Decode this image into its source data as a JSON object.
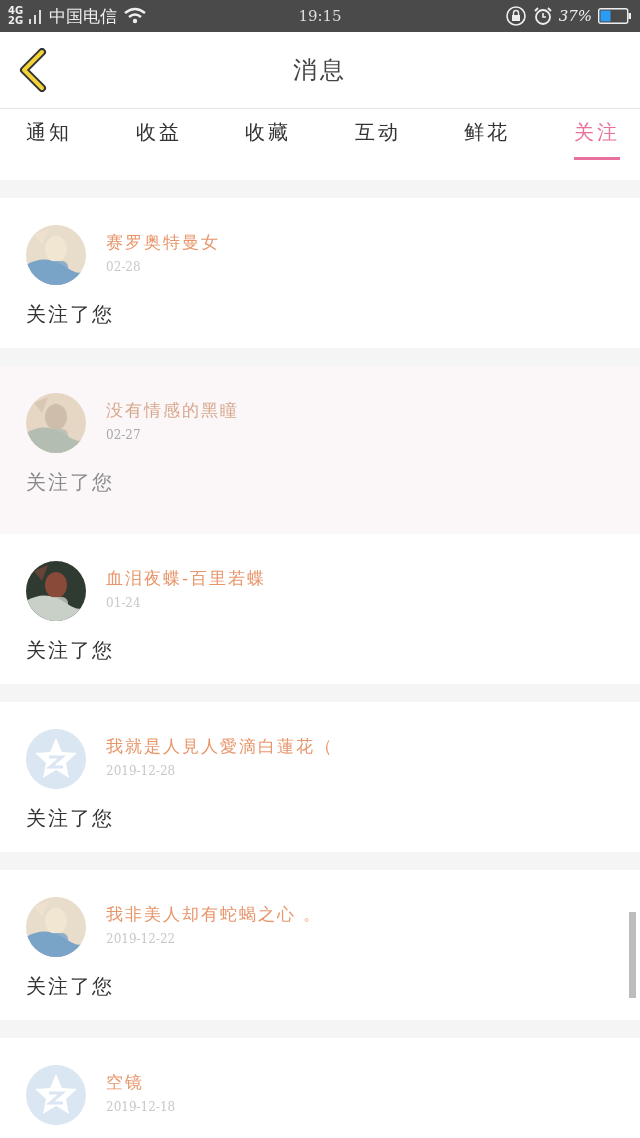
{
  "status_bar": {
    "network_top": "4G",
    "network_bottom": "2G",
    "carrier": "中国电信",
    "time": "19:15",
    "battery": "37%"
  },
  "header": {
    "title": "消息"
  },
  "tabs": [
    {
      "label": "通知",
      "selected": false
    },
    {
      "label": "收益",
      "selected": false
    },
    {
      "label": "收藏",
      "selected": false
    },
    {
      "label": "互动",
      "selected": false
    },
    {
      "label": "鲜花",
      "selected": false
    },
    {
      "label": "关注",
      "selected": true
    }
  ],
  "messages": [
    {
      "kind": "picture",
      "name": "赛罗奥特曼女",
      "date": "02-28",
      "text": "关注了您",
      "dimmed": false
    },
    {
      "kind": "picture",
      "name": "没有情感的黑瞳",
      "date": "02-27",
      "text": "关注了您",
      "dimmed": true
    },
    {
      "kind": "picture",
      "name": "血泪夜蝶-百里若蝶",
      "date": "01-24",
      "text": "关注了您",
      "dimmed": false
    },
    {
      "kind": "default",
      "name": "我就是人見人愛滴白蓮花（",
      "date": "2019-12-28",
      "text": "关注了您",
      "dimmed": false
    },
    {
      "kind": "picture",
      "name": "我非美人却有蛇蝎之心 。",
      "date": "2019-12-22",
      "text": "关注了您",
      "dimmed": false
    },
    {
      "kind": "default",
      "name": "空镜",
      "date": "2019-12-18",
      "dimmed": false
    }
  ]
}
